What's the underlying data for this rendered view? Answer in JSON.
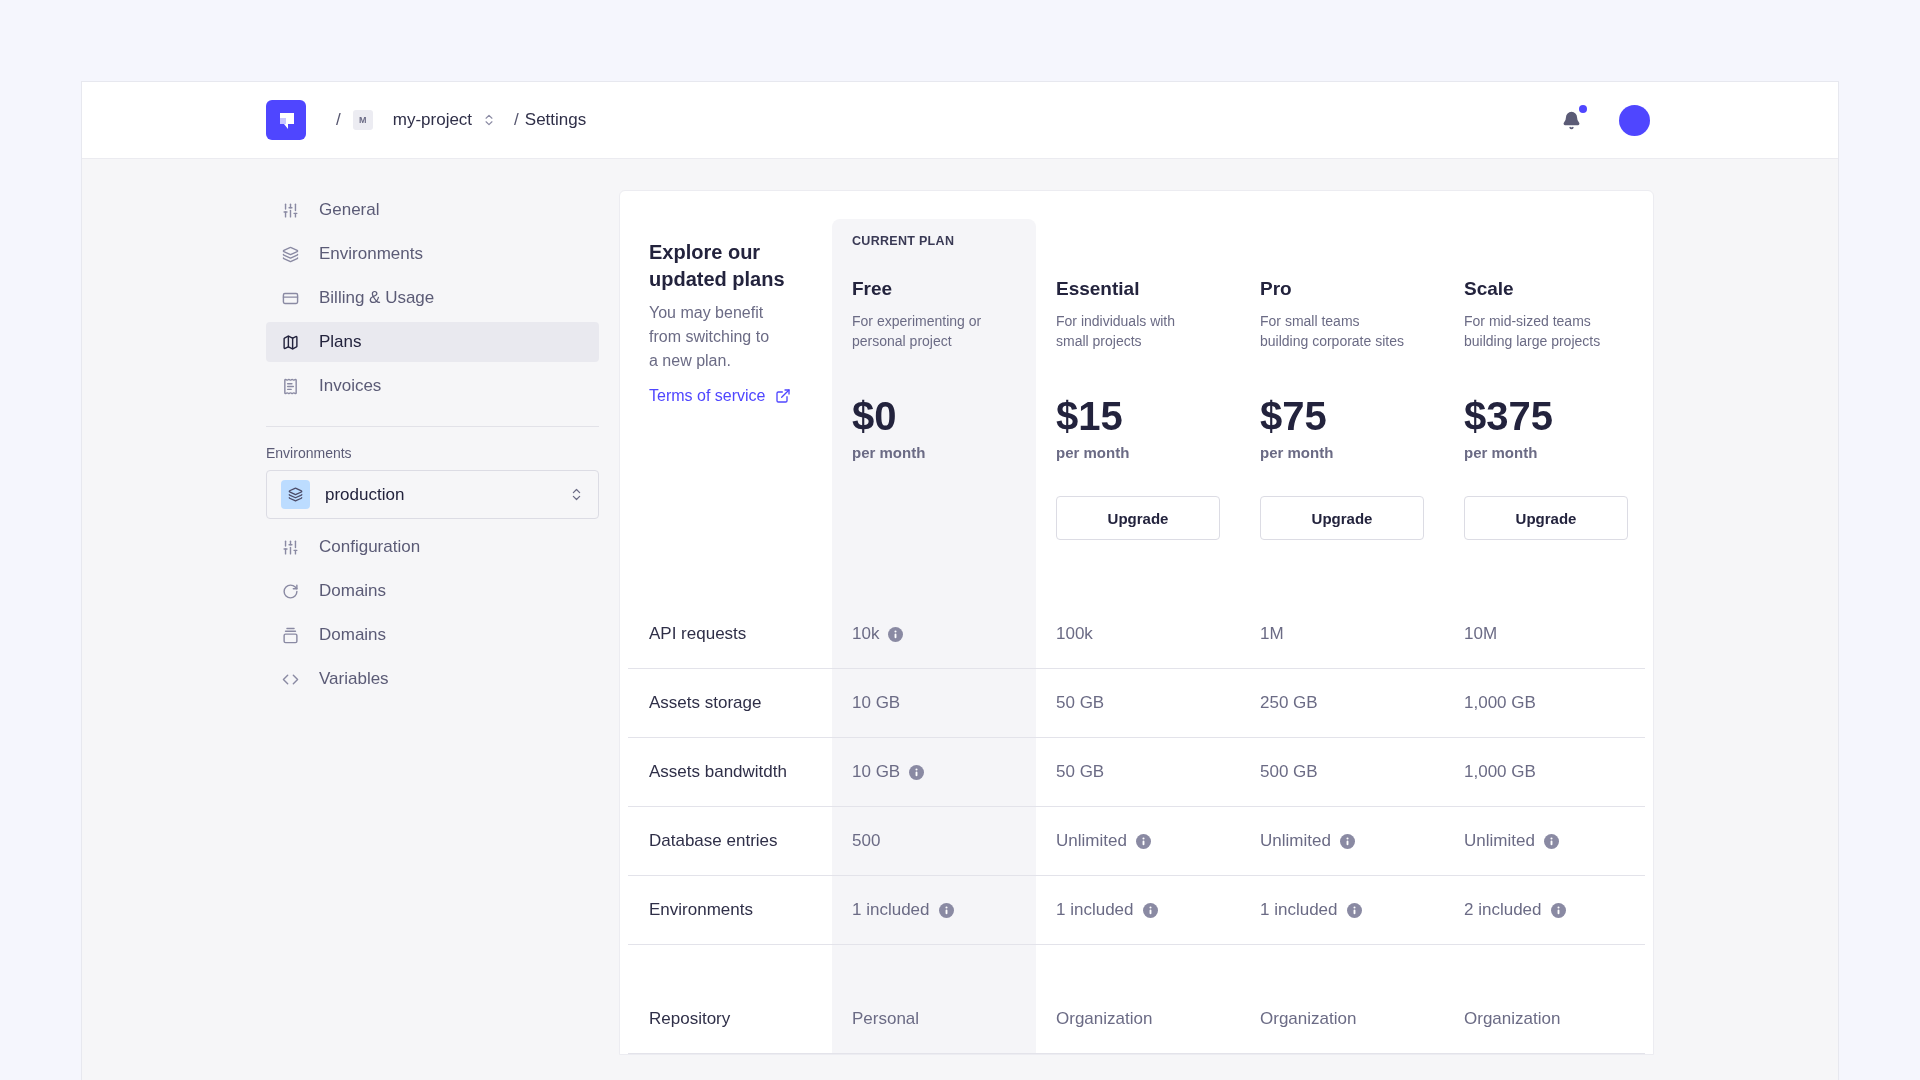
{
  "header": {
    "separators": [
      "/",
      "/"
    ],
    "project_badge": "M",
    "project": "my-project",
    "page": "Settings",
    "notifications_unread": true
  },
  "sidebar": {
    "items": [
      {
        "label": "General",
        "kind": "sliders",
        "selected": false
      },
      {
        "label": "Environments",
        "kind": "layers",
        "selected": false
      },
      {
        "label": "Billing & Usage",
        "kind": "card",
        "selected": false
      },
      {
        "label": "Plans",
        "kind": "map",
        "selected": true
      },
      {
        "label": "Invoices",
        "kind": "receipt",
        "selected": false
      }
    ],
    "environments_label": "Environments",
    "environment_select": {
      "value": "production"
    },
    "environment_items": [
      {
        "label": "Configuration",
        "kind": "sliders",
        "selected": false
      },
      {
        "label": "Domains",
        "kind": "refresh",
        "selected": false
      },
      {
        "label": "Domains",
        "kind": "stack",
        "selected": false
      },
      {
        "label": "Variables",
        "kind": "code",
        "selected": false
      }
    ]
  },
  "plans": {
    "intro": {
      "title": "Explore our\nupdated plans",
      "text": "You may benefit\nfrom switching to\na new plan.",
      "link": "Terms of service"
    },
    "columns": [
      {
        "badge": "CURRENT PLAN",
        "name": "Free",
        "description": "For experimenting or\npersonal project",
        "price": "$0",
        "period": "per month"
      },
      {
        "name": "Essential",
        "description": "For individuals with\nsmall projects",
        "price": "$15",
        "period": "per month",
        "button": "Upgrade"
      },
      {
        "name": "Pro",
        "description": "For small teams\nbuilding corporate sites",
        "price": "$75",
        "period": "per month",
        "button": "Upgrade"
      },
      {
        "name": "Scale",
        "description": "For mid-sized teams\nbuilding large projects",
        "price": "$375",
        "period": "per month",
        "button": "Upgrade"
      }
    ],
    "sections": [
      {
        "rows": [
          {
            "feature": "API requests",
            "values": [
              {
                "text": "10k",
                "info": true
              },
              {
                "text": "100k",
                "info": false
              },
              {
                "text": "1M",
                "info": false
              },
              {
                "text": "10M",
                "info": false
              }
            ]
          },
          {
            "feature": "Assets storage",
            "values": [
              {
                "text": "10 GB",
                "info": false
              },
              {
                "text": "50 GB",
                "info": false
              },
              {
                "text": "250 GB",
                "info": false
              },
              {
                "text": "1,000 GB",
                "info": false
              }
            ]
          },
          {
            "feature": "Assets bandwitdth",
            "values": [
              {
                "text": "10 GB",
                "info": true
              },
              {
                "text": "50 GB",
                "info": false
              },
              {
                "text": "500 GB",
                "info": false
              },
              {
                "text": "1,000 GB",
                "info": false
              }
            ]
          },
          {
            "feature": "Database entries",
            "values": [
              {
                "text": "500",
                "info": false
              },
              {
                "text": "Unlimited",
                "info": true
              },
              {
                "text": "Unlimited",
                "info": true
              },
              {
                "text": "Unlimited",
                "info": true
              }
            ]
          },
          {
            "feature": "Environments",
            "values": [
              {
                "text": "1 included",
                "info": true
              },
              {
                "text": "1 included",
                "info": true
              },
              {
                "text": "1 included",
                "info": true
              },
              {
                "text": "2 included",
                "info": true
              }
            ]
          }
        ]
      },
      {
        "rows": [
          {
            "feature": "Repository",
            "values": [
              {
                "text": "Personal",
                "info": false
              },
              {
                "text": "Organization",
                "info": false
              },
              {
                "text": "Organization",
                "info": false
              },
              {
                "text": "Organization",
                "info": false
              }
            ]
          }
        ]
      }
    ]
  }
}
